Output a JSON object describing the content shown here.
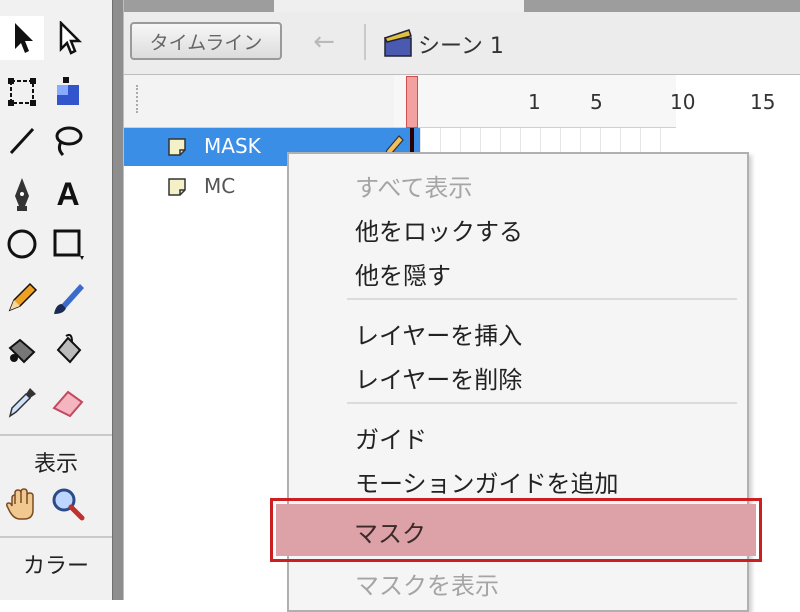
{
  "tools_panel": {
    "view_label": "表示",
    "color_label": "カラー",
    "tools": [
      {
        "name": "selection-tool",
        "icon": "arrow-icon",
        "selected": true
      },
      {
        "name": "subselection-tool",
        "icon": "subselect-arrow-icon"
      },
      {
        "name": "free-transform-tool",
        "icon": "free-transform-icon"
      },
      {
        "name": "gradient-transform-tool",
        "icon": "gradient-transform-icon"
      },
      {
        "name": "line-tool",
        "icon": "line-icon"
      },
      {
        "name": "lasso-tool",
        "icon": "lasso-icon"
      },
      {
        "name": "pen-tool",
        "icon": "pen-icon"
      },
      {
        "name": "text-tool",
        "icon": "text-icon",
        "glyph": "A"
      },
      {
        "name": "oval-tool",
        "icon": "oval-icon"
      },
      {
        "name": "rectangle-tool",
        "icon": "rectangle-icon"
      },
      {
        "name": "pencil-tool",
        "icon": "pencil-icon"
      },
      {
        "name": "brush-tool",
        "icon": "brush-icon"
      },
      {
        "name": "ink-bottle-tool",
        "icon": "ink-bottle-icon"
      },
      {
        "name": "paint-bucket-tool",
        "icon": "paint-bucket-icon"
      },
      {
        "name": "eyedropper-tool",
        "icon": "eyedropper-icon"
      },
      {
        "name": "eraser-tool",
        "icon": "eraser-icon"
      },
      {
        "name": "hand-tool",
        "icon": "hand-icon"
      },
      {
        "name": "zoom-tool",
        "icon": "zoom-icon"
      }
    ]
  },
  "edit_bar": {
    "timeline_button": "タイムライン",
    "back_icon": "back-arrow-icon",
    "scene_icon": "clapperboard-icon",
    "scene_label": "シーン 1"
  },
  "layer_header": {
    "icons": [
      "eye-icon",
      "lock-icon",
      "outline-square-icon"
    ]
  },
  "ruler": {
    "labels": [
      "1",
      "5",
      "10",
      "15"
    ]
  },
  "layers": [
    {
      "name": "MASK",
      "selected": true
    },
    {
      "name": "MC",
      "selected": false
    }
  ],
  "context_menu": {
    "items": [
      {
        "label": "すべて表示",
        "enabled": false
      },
      {
        "label": "他をロックする",
        "enabled": true
      },
      {
        "label": "他を隠す",
        "enabled": true
      },
      {
        "label": "レイヤーを挿入",
        "enabled": true
      },
      {
        "label": "レイヤーを削除",
        "enabled": true
      },
      {
        "label": "ガイド",
        "enabled": true
      },
      {
        "label": "モーションガイドを追加",
        "enabled": true
      },
      {
        "label": "マスク",
        "enabled": true,
        "highlighted": true
      },
      {
        "label": "マスクを表示",
        "enabled": false
      }
    ],
    "highlight_color": "#cc1f1f"
  },
  "colors": {
    "layer_selected": "#3a8ee6",
    "playhead": "#f2a0a0"
  }
}
